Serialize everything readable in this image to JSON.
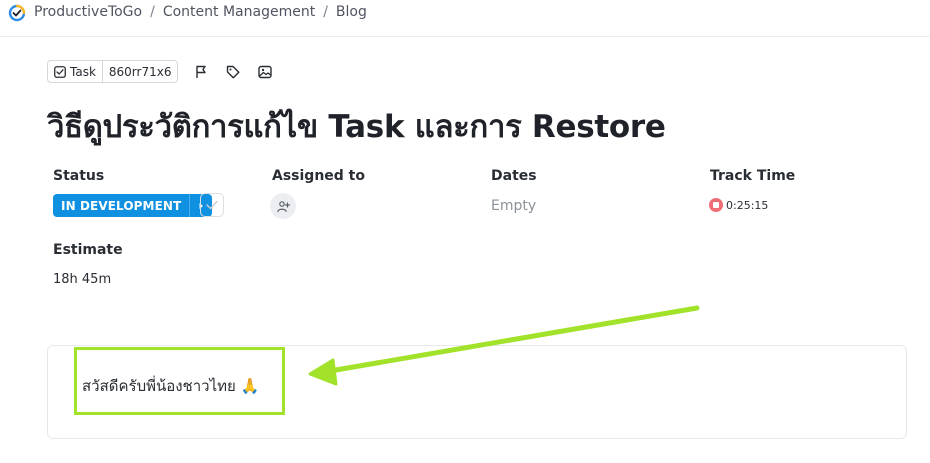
{
  "breadcrumb": {
    "items": [
      "ProductiveToGo",
      "Content Management",
      "Blog"
    ],
    "separator": "/"
  },
  "task": {
    "type_label": "Task",
    "id": "860rr71x6",
    "toolbar_icons": [
      "flag-icon",
      "tag-icon",
      "image-icon"
    ],
    "title": "วิธีดูประวัติการแก้ไข Task และการ Restore"
  },
  "fields": {
    "status": {
      "label": "Status",
      "value": "IN DEVELOPMENT",
      "color": "#1090e0"
    },
    "assigned": {
      "label": "Assigned to"
    },
    "dates": {
      "label": "Dates",
      "value": "Empty"
    },
    "track_time": {
      "label": "Track Time",
      "value": "0:25:15",
      "color": "#f06d78"
    },
    "estimate": {
      "label": "Estimate",
      "value": "18h 45m"
    }
  },
  "description": {
    "text": "สวัสดีครับพี่น้องชาวไทย 🙏"
  },
  "annotation": {
    "color": "#a3e22a"
  }
}
